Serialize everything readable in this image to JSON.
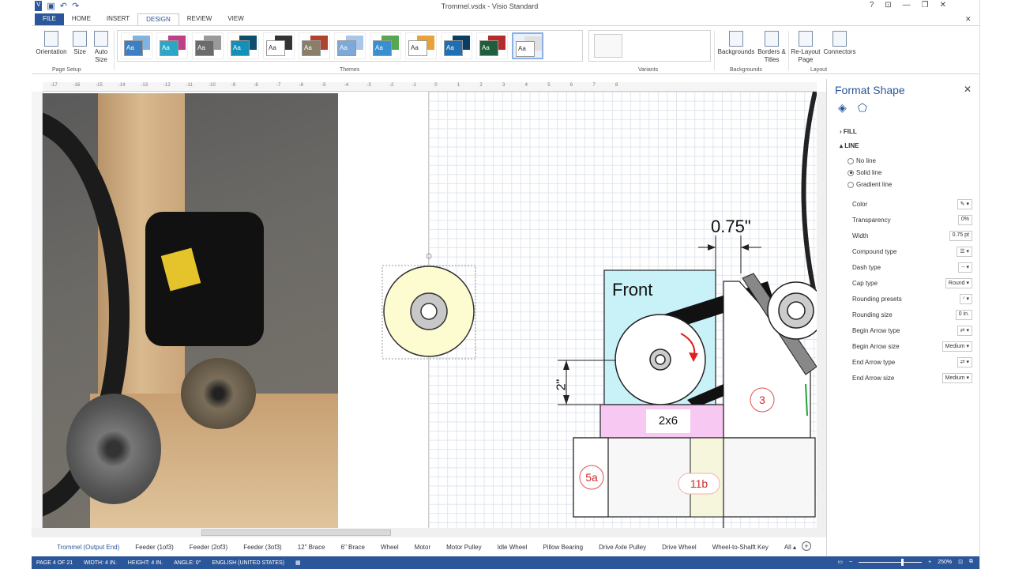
{
  "app": {
    "title": "Trommel.vsdx - Visio Standard",
    "qat_icons": [
      "visio-icon",
      "save-icon",
      "undo-icon",
      "redo-icon"
    ],
    "window_controls": [
      "?",
      "⊡",
      "—",
      "❐",
      "✕"
    ],
    "close_doc": "✕"
  },
  "tabs": [
    "FILE",
    "HOME",
    "INSERT",
    "DESIGN",
    "REVIEW",
    "VIEW"
  ],
  "ribbon": {
    "page_setup": {
      "label": "Page Setup",
      "orientation": "Orientation",
      "size": "Size",
      "auto_size": "Auto Size"
    },
    "themes_label": "Themes",
    "variants_label": "Variants",
    "backgrounds": {
      "label": "Backgrounds",
      "backgrounds_btn": "Backgrounds",
      "borders_btn": "Borders & Titles"
    },
    "layout": {
      "label": "Layout",
      "relayout_btn": "Re-Layout Page",
      "connectors_btn": "Connectors"
    },
    "theme_swatch_text": "Aa",
    "theme_colors": [
      [
        "#3e7fc1",
        "#7fb3e0"
      ],
      [
        "#2aa6c9",
        "#c03d87"
      ],
      [
        "#6b6b6b",
        "#9a9a9a"
      ],
      [
        "#138fb8",
        "#0b4f6c"
      ],
      [
        "#ffffff",
        "#333333"
      ],
      [
        "#8a7e6a",
        "#b0432b"
      ],
      [
        "#7ea8d8",
        "#a9c7e8"
      ],
      [
        "#3a8fd0",
        "#55a84f"
      ],
      [
        "#ffffff",
        "#e8a237"
      ],
      [
        "#1f6fb2",
        "#0b3d63"
      ],
      [
        "#1e5e3a",
        "#b52a2a"
      ],
      [
        "#ffffff",
        "#e0e0e0"
      ]
    ]
  },
  "ruler_ticks": [
    "-17",
    "-16",
    "-15",
    "-14",
    "-13",
    "-12",
    "-11",
    "-10",
    "-9",
    "-8",
    "-7",
    "-6",
    "-5",
    "-4",
    "-3",
    "-2",
    "-1",
    "0",
    "1",
    "2",
    "3",
    "4",
    "5",
    "6",
    "7",
    "8"
  ],
  "drawing": {
    "dim_width": "0.75\"",
    "dim_height": "2\"",
    "front_label": "Front",
    "board_label": "2x6",
    "callout_3": "3",
    "callout_5a": "5a",
    "callout_11b": "11b"
  },
  "format_shape": {
    "title": "Format Shape",
    "close": "✕",
    "fill_section": "FILL",
    "line_section": "LINE",
    "radios": [
      "No line",
      "Solid line",
      "Gradient line"
    ],
    "selected_radio": 1,
    "properties": [
      {
        "label": "Color",
        "value": "✎ ▾"
      },
      {
        "label": "Transparency",
        "value": "0%"
      },
      {
        "label": "Width",
        "value": "0.75 pt"
      },
      {
        "label": "Compound type",
        "value": "☰ ▾"
      },
      {
        "label": "Dash type",
        "value": "┈ ▾"
      },
      {
        "label": "Cap type",
        "value": "Round ▾"
      },
      {
        "label": "Rounding presets",
        "value": "◜ ▾"
      },
      {
        "label": "Rounding size",
        "value": "0 in."
      },
      {
        "label": "Begin Arrow type",
        "value": "⇄ ▾"
      },
      {
        "label": "Begin Arrow size",
        "value": "Medium ▾"
      },
      {
        "label": "End Arrow type",
        "value": "⇄ ▾"
      },
      {
        "label": "End Arrow size",
        "value": "Medium ▾"
      }
    ]
  },
  "sheet_tabs": [
    "Trommel (Output End)",
    "Feeder (1of3)",
    "Feeder (2of3)",
    "Feeder (3of3)",
    "12\" Brace",
    "6\" Brace",
    "Wheel",
    "Motor",
    "Motor Pulley",
    "Idle Wheel",
    "Pillow Bearing",
    "Drive Axle Pulley",
    "Drive Wheel",
    "Wheel-to-Shalft Key",
    "All ▴"
  ],
  "active_sheet": 0,
  "statusbar": {
    "page": "PAGE 4 OF 21",
    "width": "WIDTH: 4 IN.",
    "height": "HEIGHT: 4 IN.",
    "angle": "ANGLE: 0°",
    "language": "ENGLISH (UNITED STATES)",
    "zoom": "250%"
  }
}
